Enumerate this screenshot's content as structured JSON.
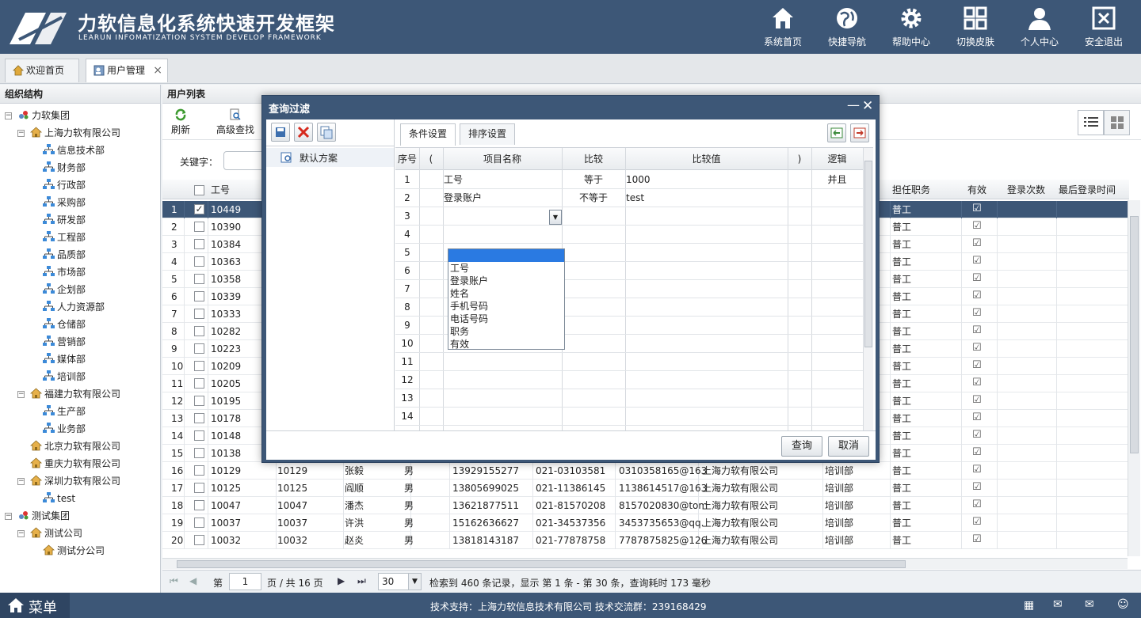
{
  "header": {
    "title": "力软信息化系统快速开发框架",
    "subtitle": "LEARUN INFOMATIZATION SYSTEM DEVELOP FRAMEWORK",
    "nav": [
      "系统首页",
      "快捷导航",
      "帮助中心",
      "切换皮肤",
      "个人中心",
      "安全退出"
    ]
  },
  "tabs": {
    "home": "欢迎首页",
    "users": "用户管理",
    "close": "×"
  },
  "left": {
    "title": "组织结构",
    "tree": [
      {
        "label": "力软集团",
        "level": 0,
        "type": "group"
      },
      {
        "label": "上海力软有限公司",
        "level": 1,
        "type": "company"
      },
      {
        "label": "信息技术部",
        "level": 2,
        "type": "dept"
      },
      {
        "label": "财务部",
        "level": 2,
        "type": "dept"
      },
      {
        "label": "行政部",
        "level": 2,
        "type": "dept"
      },
      {
        "label": "采购部",
        "level": 2,
        "type": "dept"
      },
      {
        "label": "研发部",
        "level": 2,
        "type": "dept"
      },
      {
        "label": "工程部",
        "level": 2,
        "type": "dept"
      },
      {
        "label": "品质部",
        "level": 2,
        "type": "dept"
      },
      {
        "label": "市场部",
        "level": 2,
        "type": "dept"
      },
      {
        "label": "企划部",
        "level": 2,
        "type": "dept"
      },
      {
        "label": "人力资源部",
        "level": 2,
        "type": "dept"
      },
      {
        "label": "仓储部",
        "level": 2,
        "type": "dept"
      },
      {
        "label": "营销部",
        "level": 2,
        "type": "dept"
      },
      {
        "label": "媒体部",
        "level": 2,
        "type": "dept"
      },
      {
        "label": "培训部",
        "level": 2,
        "type": "dept"
      },
      {
        "label": "福建力软有限公司",
        "level": 1,
        "type": "company"
      },
      {
        "label": "生产部",
        "level": 2,
        "type": "dept"
      },
      {
        "label": "业务部",
        "level": 2,
        "type": "dept"
      },
      {
        "label": "北京力软有限公司",
        "level": 1,
        "type": "company"
      },
      {
        "label": "重庆力软有限公司",
        "level": 1,
        "type": "company"
      },
      {
        "label": "深圳力软有限公司",
        "level": 1,
        "type": "company"
      },
      {
        "label": "test",
        "level": 2,
        "type": "dept"
      },
      {
        "label": "测试集团",
        "level": 0,
        "type": "group"
      },
      {
        "label": "测试公司",
        "level": 1,
        "type": "company"
      },
      {
        "label": "测试分公司",
        "level": 2,
        "type": "company"
      }
    ]
  },
  "list": {
    "title": "用户列表",
    "refresh": "刷新",
    "advanced_search": "高级查找",
    "keyword_label": "关键字：",
    "columns": {
      "id": "工号",
      "duty": "担任职务",
      "valid": "有效",
      "login_count": "登录次数",
      "last_login": "最后登录时间"
    },
    "rows": [
      {
        "n": "1",
        "id": "10449",
        "duty": "普工",
        "checked": true
      },
      {
        "n": "2",
        "id": "10390",
        "duty": "普工"
      },
      {
        "n": "3",
        "id": "10384",
        "duty": "普工"
      },
      {
        "n": "4",
        "id": "10363",
        "duty": "普工"
      },
      {
        "n": "5",
        "id": "10358",
        "duty": "普工"
      },
      {
        "n": "6",
        "id": "10339",
        "duty": "普工"
      },
      {
        "n": "7",
        "id": "10333",
        "duty": "普工"
      },
      {
        "n": "8",
        "id": "10282",
        "duty": "普工"
      },
      {
        "n": "9",
        "id": "10223",
        "duty": "普工"
      },
      {
        "n": "10",
        "id": "10209",
        "duty": "普工"
      },
      {
        "n": "11",
        "id": "10205",
        "duty": "普工"
      },
      {
        "n": "12",
        "id": "10195",
        "duty": "普工"
      },
      {
        "n": "13",
        "id": "10178",
        "duty": "普工"
      },
      {
        "n": "14",
        "id": "10148",
        "duty": "普工"
      },
      {
        "n": "15",
        "id": "10138",
        "duty": "普工"
      },
      {
        "n": "16",
        "id": "10129",
        "account": "10129",
        "name": "张毅",
        "sex": "男",
        "mobile": "13929155277",
        "tel": "021-03103581",
        "email": "0310358165@163",
        "company": "上海力软有限公司",
        "dept": "培训部",
        "duty": "普工"
      },
      {
        "n": "17",
        "id": "10125",
        "account": "10125",
        "name": "阎顺",
        "sex": "男",
        "mobile": "13805699025",
        "tel": "021-11386145",
        "email": "1138614517@163",
        "company": "上海力软有限公司",
        "dept": "培训部",
        "duty": "普工"
      },
      {
        "n": "18",
        "id": "10047",
        "account": "10047",
        "name": "潘杰",
        "sex": "男",
        "mobile": "13621877511",
        "tel": "021-81570208",
        "email": "8157020830@tom",
        "company": "上海力软有限公司",
        "dept": "培训部",
        "duty": "普工"
      },
      {
        "n": "19",
        "id": "10037",
        "account": "10037",
        "name": "许洪",
        "sex": "男",
        "mobile": "15162636627",
        "tel": "021-34537356",
        "email": "3453735653@qq.",
        "company": "上海力软有限公司",
        "dept": "培训部",
        "duty": "普工"
      },
      {
        "n": "20",
        "id": "10032",
        "account": "10032",
        "name": "赵炎",
        "sex": "男",
        "mobile": "13818143187",
        "tel": "021-77878758",
        "email": "7787875825@126",
        "company": "上海力软有限公司",
        "dept": "培训部",
        "duty": "普工"
      }
    ]
  },
  "pager": {
    "page_label": "第",
    "page": "1",
    "of_label": "页 / 共 16 页",
    "size": "30",
    "summary": "检索到 460 条记录，显示 第 1 条 - 第 30 条，查询耗时 173 毫秒"
  },
  "footer": {
    "menu": "菜单",
    "support": "技术支持：上海力软信息技术有限公司    技术交流群：239168429"
  },
  "dialog": {
    "title": "查询过滤",
    "scheme": "默认方案",
    "tab_conditions": "条件设置",
    "tab_sort": "排序设置",
    "columns": [
      "序号",
      "(",
      "项目名称",
      "比较",
      "比较值",
      ")",
      "逻辑"
    ],
    "rows": [
      {
        "n": "1",
        "field": "工号",
        "op": "等于",
        "value": "1000",
        "logic": "并且"
      },
      {
        "n": "2",
        "field": "登录账户",
        "op": "不等于",
        "value": "test",
        "logic": ""
      },
      {
        "n": "3"
      },
      {
        "n": "4"
      },
      {
        "n": "5"
      },
      {
        "n": "6"
      },
      {
        "n": "7"
      },
      {
        "n": "8"
      },
      {
        "n": "9"
      },
      {
        "n": "10"
      },
      {
        "n": "11"
      },
      {
        "n": "12"
      },
      {
        "n": "13"
      },
      {
        "n": "14"
      }
    ],
    "dropdown_options": [
      "工号",
      "登录账户",
      "姓名",
      "手机号码",
      "电话号码",
      "职务",
      "有效"
    ],
    "query": "查询",
    "cancel": "取消"
  },
  "colors": {
    "header": "#3d5777",
    "selected_row": "#3d5777",
    "dropdown_highlight": "#2a7ae2"
  }
}
